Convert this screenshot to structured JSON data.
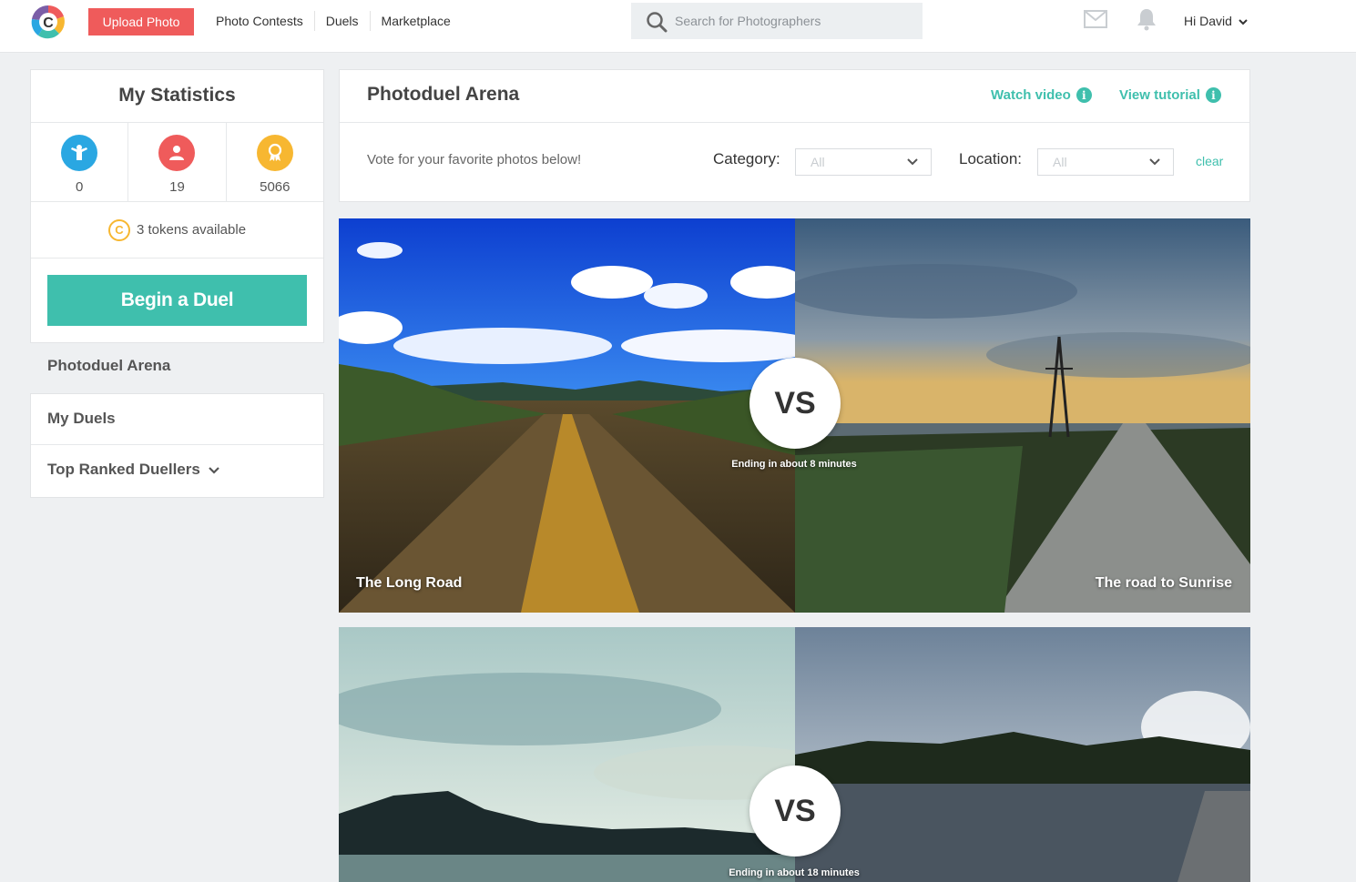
{
  "header": {
    "upload_label": "Upload Photo",
    "nav": [
      {
        "label": "Photo Contests"
      },
      {
        "label": "Duels"
      },
      {
        "label": "Marketplace"
      }
    ],
    "search_placeholder": "Search for Photographers",
    "greeting": "Hi David",
    "accent_color": "#ef5b5b"
  },
  "sidebar": {
    "stats_title": "My Statistics",
    "stats": [
      {
        "icon": "duel-person-icon",
        "value": "0",
        "color": "#2aa7e2"
      },
      {
        "icon": "user-icon",
        "value": "19",
        "color": "#ef5b5b"
      },
      {
        "icon": "award-ribbon-icon",
        "value": "5066",
        "color": "#f7b731"
      }
    ],
    "tokens_text": "3 tokens available",
    "token_symbol": "C",
    "begin_label": "Begin a Duel",
    "menu": [
      {
        "label": "Photoduel Arena"
      },
      {
        "label": "My Duels"
      },
      {
        "label": "Top Ranked Duellers"
      }
    ],
    "brand_color": "#3fbfad"
  },
  "arena": {
    "title": "Photoduel Arena",
    "watch_video": "Watch video",
    "view_tutorial": "View tutorial",
    "info_symbol": "i",
    "vote_text": "Vote for your favorite photos below!",
    "category_label": "Category:",
    "category_value": "All",
    "location_label": "Location:",
    "location_value": "All",
    "clear_label": "clear"
  },
  "duels": [
    {
      "left_title": "The Long Road",
      "right_title": "The road to Sunrise",
      "vs": "VS",
      "ending": "Ending in about 8 minutes"
    },
    {
      "left_title": "",
      "right_title": "",
      "vs": "VS",
      "ending": "Ending in about 18 minutes"
    }
  ]
}
